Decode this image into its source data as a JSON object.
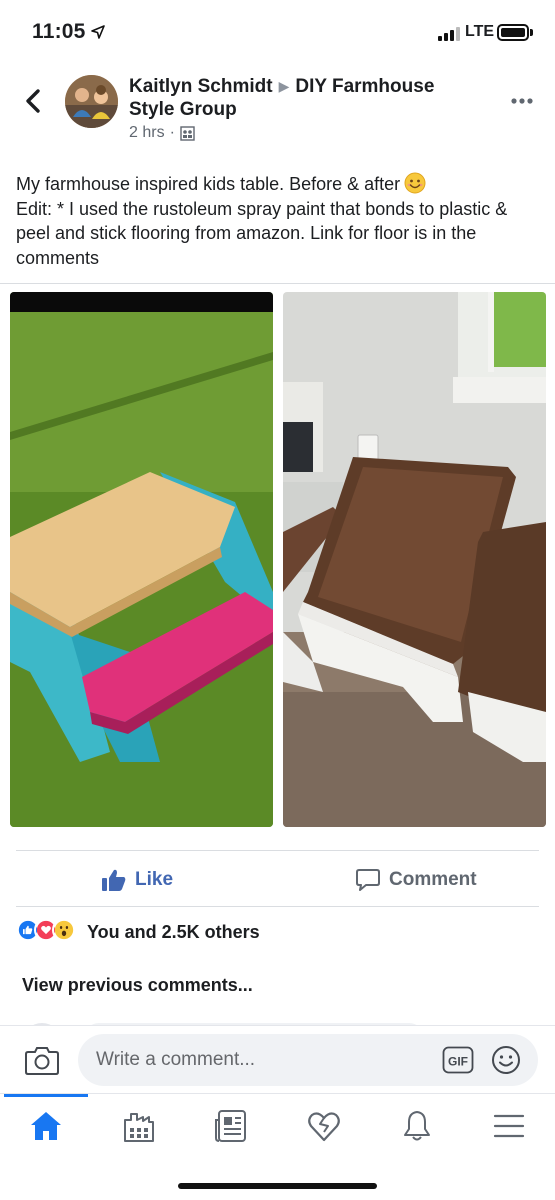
{
  "status_bar": {
    "time": "11:05",
    "network": "LTE"
  },
  "post": {
    "author": "Kaitlyn Schmidt",
    "group": "DIY Farmhouse Style Group",
    "time_ago": "2 hrs",
    "text_line1": "My farmhouse inspired kids table. Before & after",
    "text_rest": "Edit: * I used the rustoleum spray paint that bonds to plastic & peel and stick flooring from amazon. Link for floor is in the comments",
    "photos": [
      "before-photo",
      "after-photo"
    ]
  },
  "actions": {
    "like_label": "Like",
    "comment_label": "Comment"
  },
  "reactions": {
    "summary": "You and 2.5K others",
    "types": [
      "like-icon",
      "love-icon",
      "wow-icon"
    ]
  },
  "comments": {
    "view_previous": "View previous comments..."
  },
  "composer": {
    "placeholder": "Write a comment...",
    "gif_label": "GIF"
  },
  "tabs": [
    "home-icon",
    "marketplace-icon",
    "news-icon",
    "dating-icon",
    "notifications-icon",
    "menu-icon"
  ],
  "colors": {
    "facebook_blue": "#4267b2",
    "active_tab_blue": "#1877f2"
  }
}
